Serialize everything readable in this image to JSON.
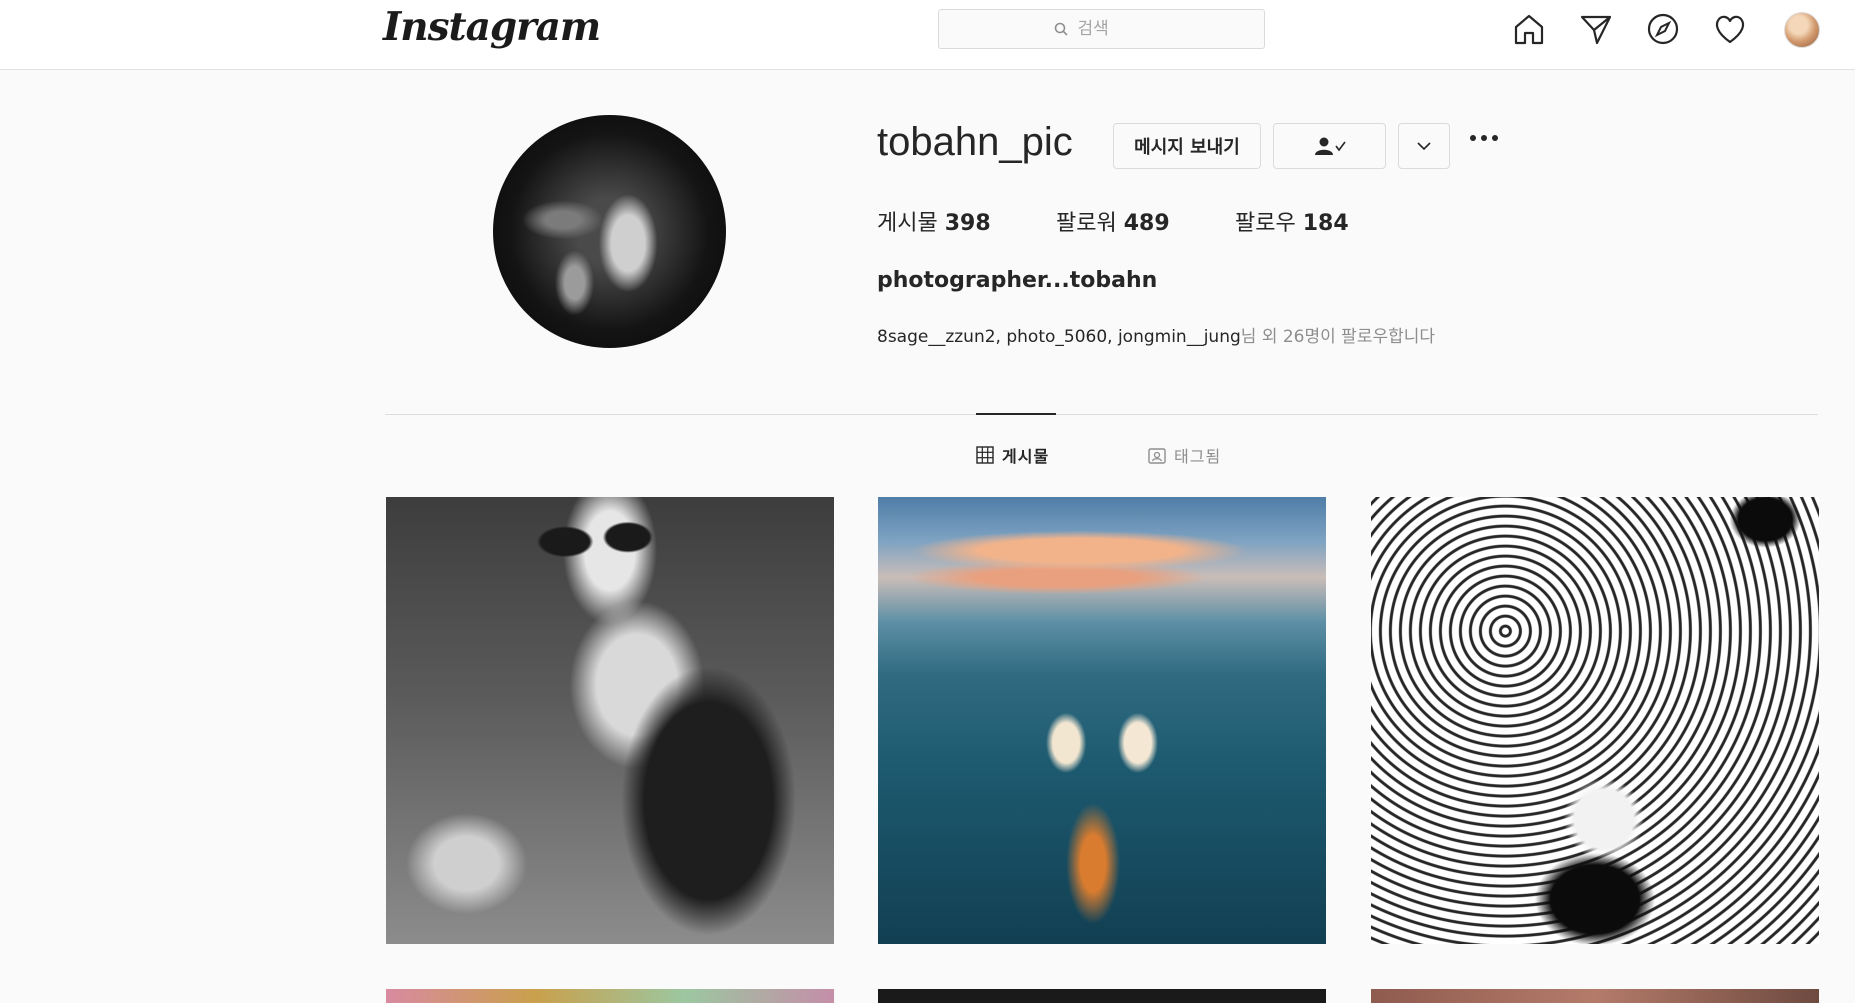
{
  "nav": {
    "logo": "Instagram",
    "search_placeholder": "검색",
    "icons": [
      "home-icon",
      "direct-icon",
      "explore-icon",
      "activity-heart-icon",
      "profile-avatar"
    ]
  },
  "profile": {
    "username": "tobahn_pic",
    "message_button": "메시지 보내기",
    "stats": {
      "posts_label": "게시물",
      "posts_count": "398",
      "followers_label": "팔로워",
      "followers_count": "489",
      "following_label": "팔로우",
      "following_count": "184"
    },
    "full_name": "photographer...tobahn",
    "followed_by_names": "8sage__zzun2, photo_5060, jongmin__jung",
    "followed_by_suffix": "님 외 26명이 팔로우합니다"
  },
  "tabs": [
    {
      "label": "게시물",
      "active": true
    },
    {
      "label": "태그됨",
      "active": false
    }
  ],
  "colors": {
    "background": "#fafafa",
    "text": "#262626",
    "muted": "#8e8e8e",
    "border": "#dbdbdb"
  }
}
